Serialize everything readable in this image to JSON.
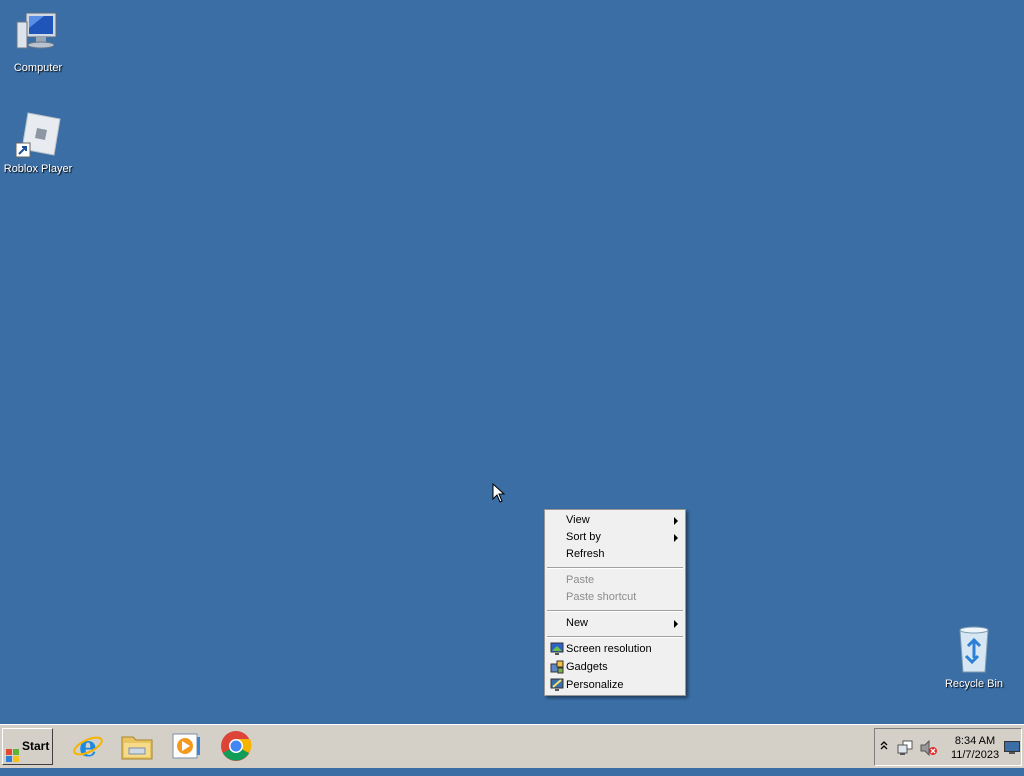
{
  "desktop": {
    "icons": [
      {
        "label": "Computer",
        "icon": "computer-icon"
      },
      {
        "label": "Roblox Player",
        "icon": "roblox-icon"
      },
      {
        "label": "Recycle Bin",
        "icon": "recycle-bin-icon"
      }
    ],
    "background_color": "#3a6ea5"
  },
  "context_menu": {
    "items": [
      {
        "label": "View",
        "submenu": true,
        "enabled": true
      },
      {
        "label": "Sort by",
        "submenu": true,
        "enabled": true
      },
      {
        "label": "Refresh",
        "enabled": true
      },
      {
        "label": "Paste",
        "enabled": false
      },
      {
        "label": "Paste shortcut",
        "enabled": false
      },
      {
        "label": "New",
        "submenu": true,
        "enabled": true
      },
      {
        "label": "Screen resolution",
        "icon": "screen-resolution-icon",
        "enabled": true
      },
      {
        "label": "Gadgets",
        "icon": "gadgets-icon",
        "enabled": true
      },
      {
        "label": "Personalize",
        "icon": "personalize-icon",
        "enabled": true
      }
    ]
  },
  "taskbar": {
    "start_label": "Start",
    "pinned": [
      {
        "icon": "internet-explorer-icon"
      },
      {
        "icon": "file-explorer-icon"
      },
      {
        "icon": "media-player-icon"
      },
      {
        "icon": "chrome-icon"
      }
    ],
    "tray": {
      "time": "8:34 AM",
      "date": "11/7/2023",
      "icons": [
        "show-hidden-icons-chevron-icon",
        "network-icon",
        "volume-muted-icon",
        "show-desktop-icon"
      ]
    }
  }
}
